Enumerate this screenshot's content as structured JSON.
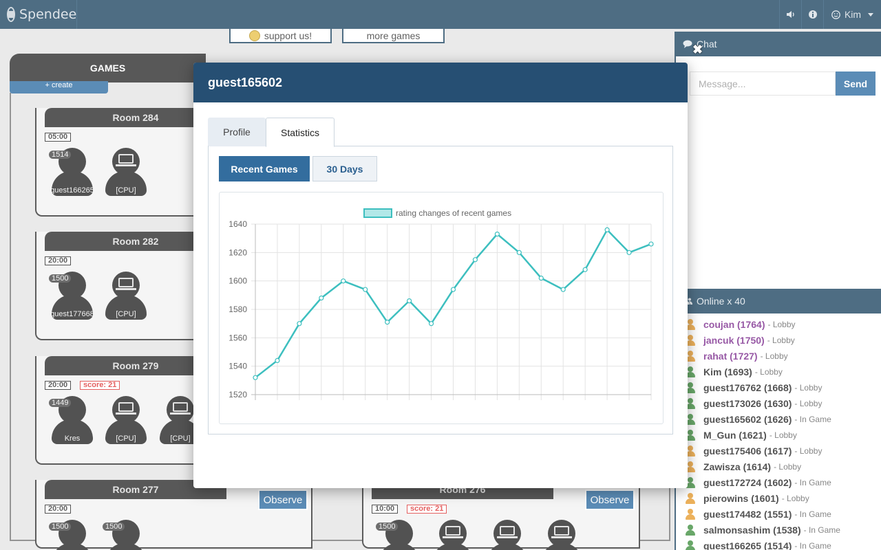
{
  "app": {
    "name": "Spendee"
  },
  "topbar": {
    "user": "Kim",
    "sound_icon": "volume-icon",
    "info_icon": "info-icon",
    "user_icon": "smile-icon"
  },
  "promo": {
    "support": "support us!",
    "more_games": "more games"
  },
  "games": {
    "title": "GAMES",
    "create": "+ create",
    "observe_label": "Observe",
    "rooms": [
      {
        "name": "Room 284",
        "timer": "05:00",
        "players": [
          {
            "rating": "1514",
            "name": "guest166265",
            "type": "human"
          },
          {
            "rating": "",
            "name": "[CPU]",
            "type": "cpu"
          }
        ]
      },
      {
        "name": "Room 282",
        "timer": "20:00",
        "players": [
          {
            "rating": "1500",
            "name": "guest177668",
            "type": "human"
          },
          {
            "rating": "",
            "name": "[CPU]",
            "type": "cpu"
          }
        ]
      },
      {
        "name": "Room 279",
        "timer": "20:00",
        "score": "score: 21",
        "players": [
          {
            "rating": "1449",
            "name": "Kres",
            "type": "human"
          },
          {
            "rating": "",
            "name": "[CPU]",
            "type": "cpu"
          },
          {
            "rating": "",
            "name": "[CPU]",
            "type": "cpu"
          }
        ]
      },
      {
        "name": "Room 277",
        "timer": "20:00",
        "players": [
          {
            "rating": "1500",
            "name": "",
            "type": "human"
          },
          {
            "rating": "1500",
            "name": "",
            "type": "human"
          }
        ]
      },
      {
        "name": "Room 276",
        "timer": "10:00",
        "score": "score: 21",
        "players": [
          {
            "rating": "1500",
            "name": "",
            "type": "human"
          },
          {
            "rating": "",
            "name": "",
            "type": "cpu"
          },
          {
            "rating": "",
            "name": "",
            "type": "cpu"
          },
          {
            "rating": "",
            "name": "",
            "type": "cpu"
          }
        ]
      }
    ]
  },
  "chat": {
    "title": "Chat",
    "placeholder": "Message...",
    "send": "Send"
  },
  "online": {
    "title": "Online x 40",
    "users": [
      {
        "name": "coujan (1764)",
        "status": "- Lobby",
        "color": "#7a2a8c",
        "icon": "#e79b2e"
      },
      {
        "name": "jancuk (1750)",
        "status": "- Lobby",
        "color": "#7a2a8c",
        "icon": "#e79b2e"
      },
      {
        "name": "rahat (1727)",
        "status": "- Lobby",
        "color": "#7a2a8c",
        "icon": "#e79b2e"
      },
      {
        "name": "Kim (1693)",
        "status": "- Lobby",
        "color": "#222222",
        "icon": "#3f8f3f"
      },
      {
        "name": "guest176762 (1668)",
        "status": "- Lobby",
        "color": "#222222",
        "icon": "#3f8f3f"
      },
      {
        "name": "guest173026 (1630)",
        "status": "- Lobby",
        "color": "#222222",
        "icon": "#3f8f3f"
      },
      {
        "name": "guest165602 (1626)",
        "status": "- In Game",
        "color": "#222222",
        "icon": "#3f8f3f"
      },
      {
        "name": "M_Gun (1621)",
        "status": "- Lobby",
        "color": "#222222",
        "icon": "#3f8f3f"
      },
      {
        "name": "guest175406 (1617)",
        "status": "- Lobby",
        "color": "#222222",
        "icon": "#e79b2e"
      },
      {
        "name": "Zawisza (1614)",
        "status": "- Lobby",
        "color": "#222222",
        "icon": "#e79b2e"
      },
      {
        "name": "guest172724 (1602)",
        "status": "- In Game",
        "color": "#222222",
        "icon": "#3f8f3f"
      },
      {
        "name": "pierowins (1601)",
        "status": "- Lobby",
        "color": "#222222",
        "icon": "#e79b2e"
      },
      {
        "name": "guest174482 (1551)",
        "status": "- In Game",
        "color": "#222222",
        "icon": "#e79b2e"
      },
      {
        "name": "salmonsashim (1538)",
        "status": "- In Game",
        "color": "#222222",
        "icon": "#3f8f3f"
      },
      {
        "name": "guest166265 (1514)",
        "status": "- In Game",
        "color": "#222222",
        "icon": "#3f8f3f"
      }
    ]
  },
  "modal": {
    "title": "guest165602",
    "tabs": {
      "profile": "Profile",
      "statistics": "Statistics"
    },
    "subtabs": {
      "recent": "Recent Games",
      "days30": "30 Days"
    }
  },
  "colors": {
    "line": "#3dbfbf",
    "header": "#1d4561",
    "accent": "#2d6ca2"
  },
  "chart_data": {
    "type": "line",
    "series": [
      {
        "name": "rating changes of recent games",
        "values": [
          1532,
          1544,
          1570,
          1588,
          1600,
          1594,
          1571,
          1586,
          1570,
          1594,
          1615,
          1633,
          1620,
          1602,
          1594,
          1608,
          1636,
          1620,
          1626
        ]
      }
    ],
    "ylim": [
      1520,
      1640
    ],
    "yticks": [
      1520,
      1540,
      1560,
      1580,
      1600,
      1620,
      1640
    ],
    "grid": true,
    "legend": "top"
  }
}
